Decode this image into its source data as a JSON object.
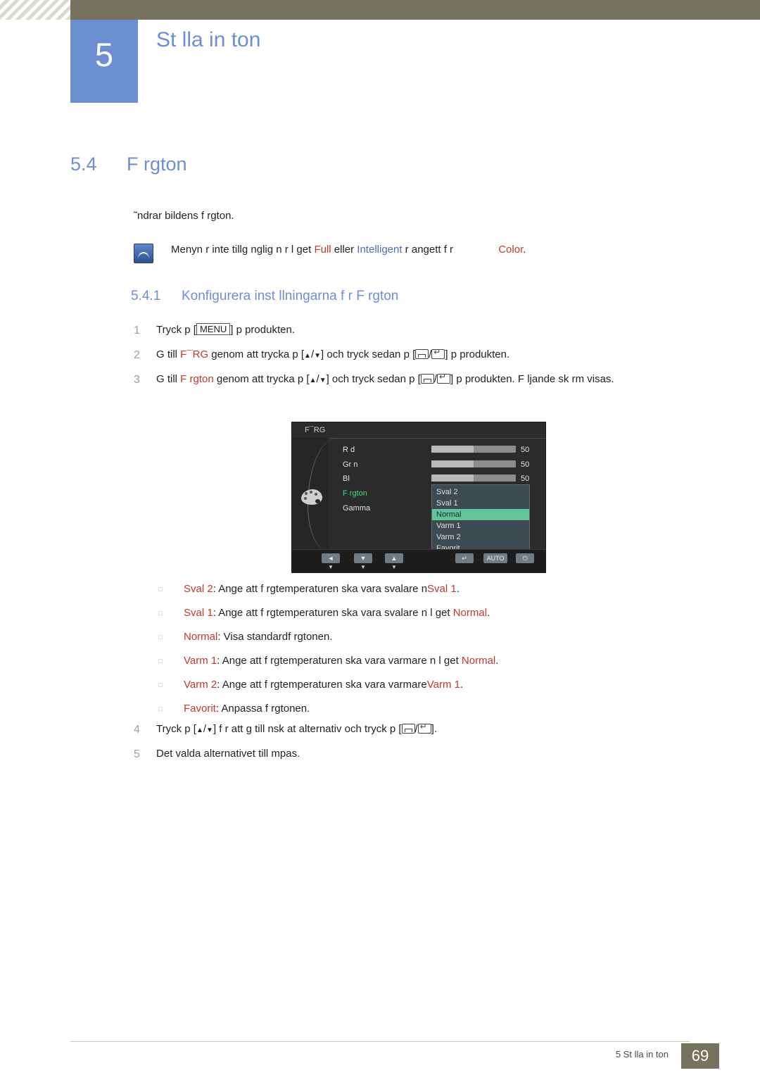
{
  "header": {
    "chapter_number": "5",
    "chapter_title": "St lla in ton"
  },
  "section": {
    "number": "5.4",
    "title": "F rgton",
    "intro": "˜ndrar bildens f rgton."
  },
  "note": {
    "icon": "note-icon",
    "part1": "Menyn  r inte tillg nglig n r l get ",
    "full": "Full",
    "part2": " eller ",
    "intelligent": "Intelligent",
    "part3": " r angett f r ",
    "color": "Color",
    "period": "."
  },
  "subsection": {
    "number": "5.4.1",
    "title": "Konfigurera inst llningarna f r F rgton"
  },
  "steps": [
    {
      "num": "1",
      "text_a": "Tryck p  [",
      "menu_key": "MENU",
      "text_b": "] p  produkten."
    },
    {
      "num": "2",
      "text_a": "G  till ",
      "term": "F¯RG",
      "text_b": " genom att trycka p  [",
      "text_c": "] och tryck sedan p  [",
      "text_d": "] p  produkten."
    },
    {
      "num": "3",
      "text_a": "G  till ",
      "term": "F rgton",
      "text_b": " genom att trycka p  [",
      "text_c": "] och tryck sedan p  [",
      "text_d": "] p  produkten. F ljande sk rm visas."
    },
    {
      "num": "4",
      "text_a": "Tryck p  [",
      "text_b": "] f r att g  till nsk at alternativ och tryck p  [",
      "text_c": "]."
    },
    {
      "num": "5",
      "text_a": "Det valda alternativet till mpas."
    }
  ],
  "osd": {
    "title": "F¯RG",
    "icon": "palette-icon",
    "rows": [
      {
        "label": "R d",
        "value": "50",
        "fill_pct": 50
      },
      {
        "label": "Gr n",
        "value": "50",
        "fill_pct": 50
      },
      {
        "label": "Bl",
        "value": "50",
        "fill_pct": 50
      }
    ],
    "labels": [
      {
        "name": "F rgton",
        "highlight": true
      },
      {
        "name": "Gamma",
        "highlight": false
      }
    ],
    "menu_items": [
      {
        "label": "Sval 2",
        "selected": false
      },
      {
        "label": "Sval 1",
        "selected": false
      },
      {
        "label": "Normal",
        "selected": true
      },
      {
        "label": "Varm 1",
        "selected": false
      },
      {
        "label": "Varm 2",
        "selected": false
      },
      {
        "label": "Favorit",
        "selected": false
      }
    ],
    "footer_buttons": [
      {
        "glyph": "◄",
        "sub": "▼"
      },
      {
        "glyph": "▼",
        "sub": "▼"
      },
      {
        "glyph": "▲",
        "sub": "▼"
      },
      {
        "glyph": "↵",
        "sub": ""
      },
      {
        "glyph": "AUTO",
        "sub": ""
      },
      {
        "glyph": "⏻",
        "sub": ""
      }
    ]
  },
  "bullets": [
    {
      "term": "Sval 2",
      "rest": ": Ange att f rgtemperaturen ska vara svalare  n",
      "term2": "Sval 1",
      "tail": "."
    },
    {
      "term": "Sval 1",
      "rest": ": Ange att f rgtemperaturen ska vara svalare  n l get ",
      "term2": "Normal",
      "tail": "."
    },
    {
      "term": "Normal",
      "rest": ": Visa standardf rgtonen.",
      "term2": "",
      "tail": ""
    },
    {
      "term": "Varm 1",
      "rest": ": Ange att f rgtemperaturen ska vara varmare  n l get ",
      "term2": "Normal",
      "tail": "."
    },
    {
      "term": "Varm 2",
      "rest": ": Ange att f rgtemperaturen ska vara varmare",
      "term2": "Varm 1",
      "tail": "."
    },
    {
      "term": "Favorit",
      "rest": ": Anpassa f rgtonen.",
      "term2": "",
      "tail": ""
    }
  ],
  "footer": {
    "text": "5 St lla in ton",
    "page": "69"
  },
  "colors": {
    "accent_blue": "#6c8fd4",
    "term_red": "#c0392b",
    "header_olive": "#75725e",
    "osd_highlight": "#62c49a"
  }
}
